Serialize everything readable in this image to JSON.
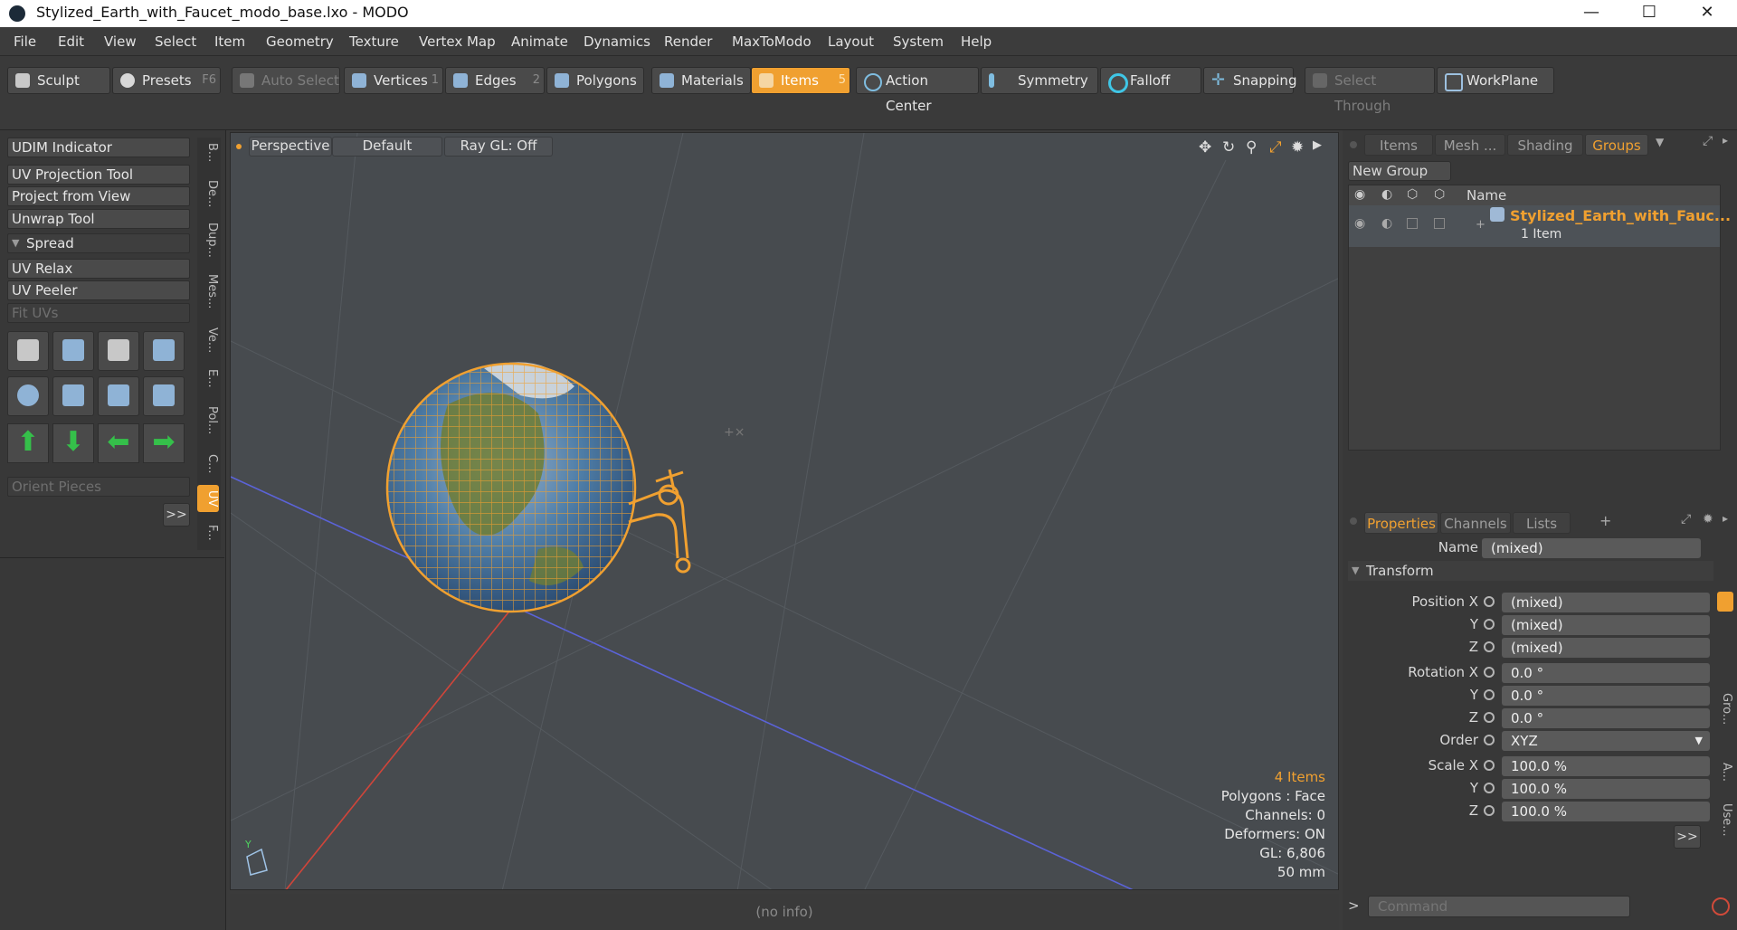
{
  "window": {
    "title": "Stylized_Earth_with_Faucet_modo_base.lxo - MODO",
    "minimize": "—",
    "maximize": "☐",
    "close": "✕"
  },
  "menu": [
    "File",
    "Edit",
    "View",
    "Select",
    "Item",
    "Geometry",
    "Texture",
    "Vertex Map",
    "Animate",
    "Dynamics",
    "Render",
    "MaxToModo",
    "Layout",
    "System",
    "Help"
  ],
  "toolbar": {
    "sculpt": "Sculpt",
    "presets": "Presets",
    "presets_key": "F6",
    "auto_select": "Auto Select",
    "vertices": "Vertices",
    "vertices_num": "1",
    "edges": "Edges",
    "edges_num": "2",
    "polygons": "Polygons",
    "materials": "Materials",
    "items": "Items",
    "items_num": "5",
    "action_center": "Action Center",
    "symmetry": "Symmetry",
    "falloff": "Falloff",
    "snapping": "Snapping",
    "select_through": "Select Through",
    "workplane": "WorkPlane"
  },
  "left": {
    "udim": "UDIM Indicator",
    "uv_projection": "UV Projection Tool",
    "project_from_view": "Project from View",
    "unwrap": "Unwrap Tool",
    "spread": "Spread",
    "uv_relax": "UV Relax",
    "uv_peeler": "UV Peeler",
    "fit_uvs": "Fit UVs",
    "orient_pieces": "Orient Pieces",
    "more": ">>",
    "vtabs": [
      "B...",
      "De...",
      "Dup...",
      "Mes...",
      "Ve...",
      "E...",
      "Pol...",
      "C...",
      "UV",
      "F..."
    ]
  },
  "viewport": {
    "view": "Perspective",
    "shading": "Default",
    "raygl": "Ray GL: Off",
    "status": {
      "items": "4 Items",
      "polygons": "Polygons : Face",
      "channels": "Channels: 0",
      "deformers": "Deformers: ON",
      "gl": "GL: 6,806",
      "lens": "50 mm"
    },
    "noinfo": "(no info)"
  },
  "right": {
    "tabs": [
      "Items",
      "Mesh ...",
      "Shading",
      "Groups"
    ],
    "new_group": "New Group",
    "col_name": "Name",
    "group_name": "Stylized_Earth_with_Fauc...",
    "group_count": "1 Item",
    "props_tabs": [
      "Properties",
      "Channels",
      "Lists"
    ],
    "name_label": "Name",
    "name_value": "(mixed)",
    "transform": "Transform",
    "position_x_label": "Position X",
    "y_label": "Y",
    "z_label": "Z",
    "pos_x": "(mixed)",
    "pos_y": "(mixed)",
    "pos_z": "(mixed)",
    "rotation_x_label": "Rotation X",
    "rot_x": "0.0 °",
    "rot_y": "0.0 °",
    "rot_z": "0.0 °",
    "order_label": "Order",
    "order_value": "XYZ",
    "scale_x_label": "Scale X",
    "scale_x": "100.0 %",
    "scale_y": "100.0 %",
    "scale_z": "100.0 %",
    "more": ">>",
    "side_tabs": [
      "Gro...",
      "A...",
      "Use..."
    ],
    "command_placeholder": "Command"
  }
}
